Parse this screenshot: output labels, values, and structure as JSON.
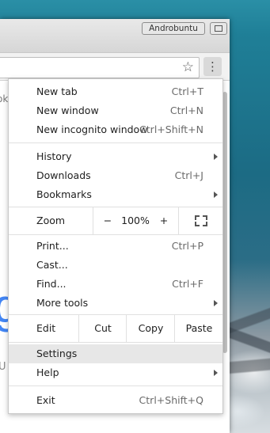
{
  "desktop": {
    "titlebar_label": "Androbuntu"
  },
  "browser": {
    "menu_button_icon": "three-dot-vertical-icon",
    "bookmark_icon": "star-outline-icon",
    "page_peek": {
      "top_text": "ok",
      "big_letter": "g",
      "bottom_text": "U"
    }
  },
  "menu": {
    "group1": [
      {
        "label": "New tab",
        "shortcut": "Ctrl+T"
      },
      {
        "label": "New window",
        "shortcut": "Ctrl+N"
      },
      {
        "label": "New incognito window",
        "shortcut": "Ctrl+Shift+N"
      }
    ],
    "group2": [
      {
        "label": "History",
        "shortcut": "",
        "submenu": true
      },
      {
        "label": "Downloads",
        "shortcut": "Ctrl+J"
      },
      {
        "label": "Bookmarks",
        "shortcut": "",
        "submenu": true
      }
    ],
    "zoom": {
      "label": "Zoom",
      "minus": "−",
      "value": "100%",
      "plus": "+",
      "fullscreen_icon": "fullscreen-icon"
    },
    "group3": [
      {
        "label": "Print...",
        "shortcut": "Ctrl+P"
      },
      {
        "label": "Cast...",
        "shortcut": ""
      },
      {
        "label": "Find...",
        "shortcut": "Ctrl+F"
      },
      {
        "label": "More tools",
        "shortcut": "",
        "submenu": true
      }
    ],
    "edit": {
      "label": "Edit",
      "cut": "Cut",
      "copy": "Copy",
      "paste": "Paste"
    },
    "group4": [
      {
        "label": "Settings",
        "shortcut": "",
        "highlighted": true
      },
      {
        "label": "Help",
        "shortcut": "",
        "submenu": true
      }
    ],
    "exit": {
      "label": "Exit",
      "shortcut": "Ctrl+Shift+Q"
    }
  }
}
